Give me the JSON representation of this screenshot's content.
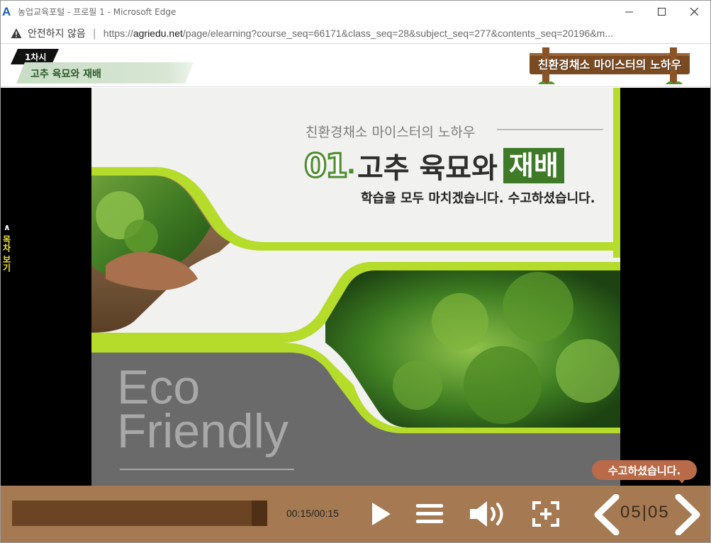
{
  "window": {
    "app_icon": "A",
    "title": "농업교육포털 - 프로필 1 - Microsoft Edge",
    "controls": [
      "minimize-icon",
      "maximize-icon",
      "close-icon"
    ]
  },
  "address": {
    "security_label": "안전하지 않음",
    "url_prefix": "https://",
    "url_domain": "agriedu.net",
    "url_rest": "/page/elearning?course_seq=66171&class_seq=28&subject_seq=277&contents_seq=20196&m..."
  },
  "header": {
    "lesson_tag": "1차시",
    "lesson_title": "고추 육묘와 재배",
    "brand": "친환경채소 마이스터의 노하우"
  },
  "sidebar": {
    "toc_label": "목차 보기",
    "caret": "<"
  },
  "slide": {
    "subtitle": "친환경채소 마이스터의 노하우",
    "number": "01",
    "dot": ".",
    "title_main": "고추 육묘와",
    "title_box": "재배",
    "message": "학습을 모두 마치겠습니다. 수고하셨습니다.",
    "eco_line1": "Eco",
    "eco_line2": "Friendly"
  },
  "bubble": {
    "text": "수고하셨습니다."
  },
  "player": {
    "time_current": "00:15",
    "time_sep": "/",
    "time_total": "00:15",
    "progress": 1.0,
    "page_current": "05",
    "page_sep": "|",
    "page_total": "05",
    "icons": [
      "play-icon",
      "menu-icon",
      "volume-icon",
      "fullscreen-icon",
      "prev-icon",
      "next-icon"
    ]
  },
  "colors": {
    "control_bar": "#a57a52",
    "progress_track": "#6b4423",
    "accent_green": "#3f7a29",
    "lime": "#b5db2b",
    "bubble": "#b96b49"
  }
}
